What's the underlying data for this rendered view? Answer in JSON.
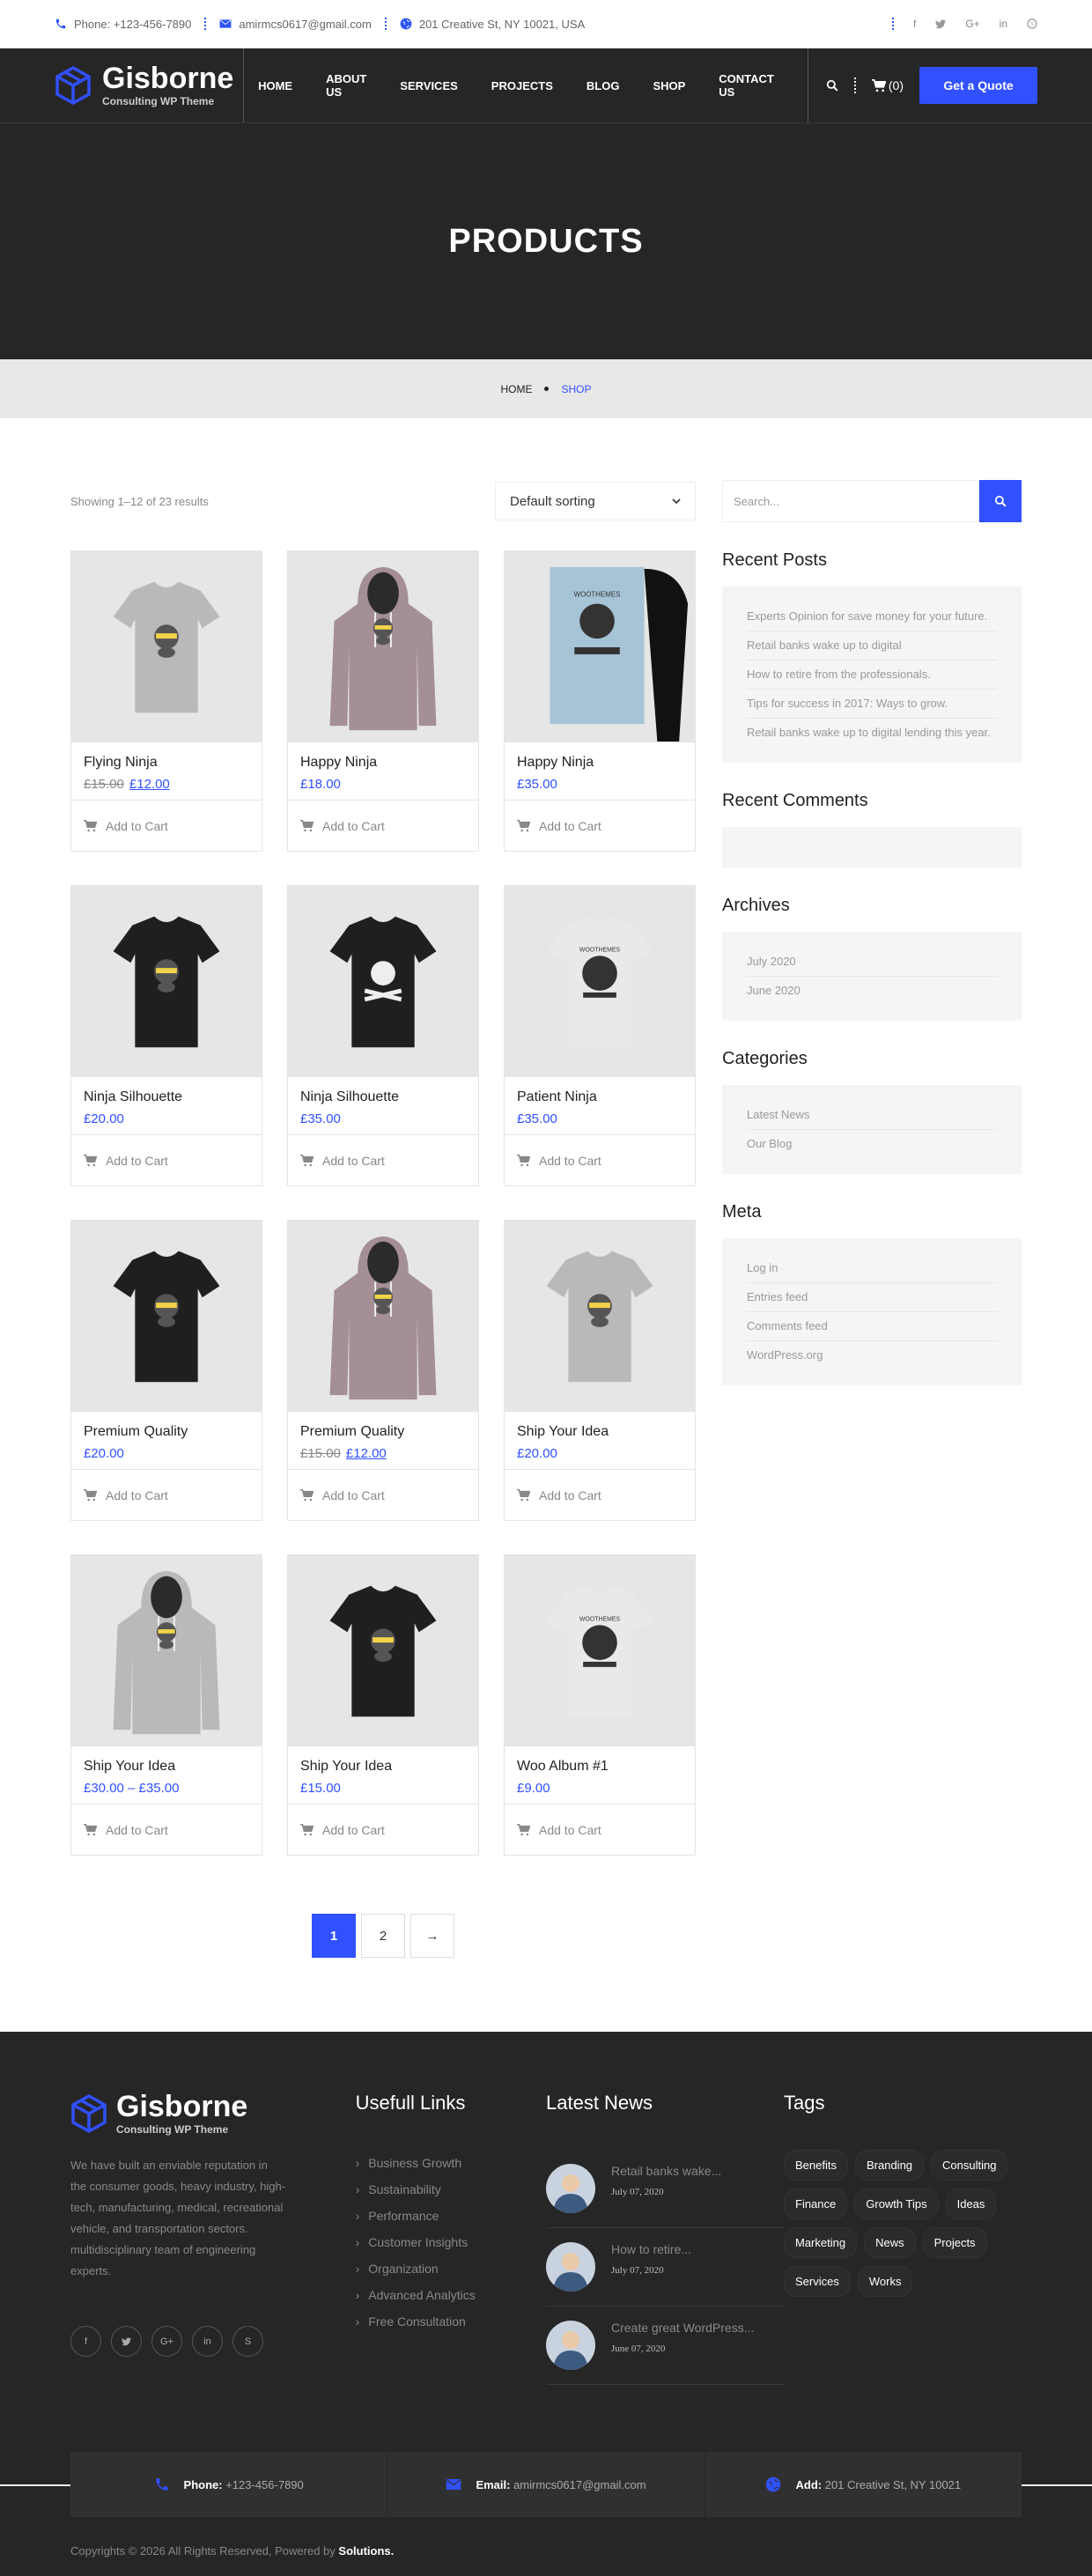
{
  "topbar": {
    "phone": "Phone: +123-456-7890",
    "email": "amirmcs0617@gmail.com",
    "address": "201 Creative St, NY 10021, USA"
  },
  "brand": {
    "name": "Gisborne",
    "tagline": "Consulting WP Theme"
  },
  "nav": [
    "HOME",
    "ABOUT US",
    "SERVICES",
    "PROJECTS",
    "BLOG",
    "SHOP",
    "CONTACT US"
  ],
  "header": {
    "cart": "(0)",
    "quote": "Get a Quote"
  },
  "hero": {
    "title": "PRODUCTS"
  },
  "breadcrumb": {
    "home": "HOME",
    "current": "SHOP"
  },
  "shop": {
    "result_count": "Showing 1–12 of 23 results",
    "sorting": "Default sorting",
    "add_to_cart": "Add to Cart"
  },
  "products": [
    {
      "name": "Flying Ninja",
      "old": "£15.00",
      "price": "£12.00",
      "kind": "tshirt-grey"
    },
    {
      "name": "Happy Ninja",
      "old": "",
      "price": "£18.00",
      "kind": "hoodie-pink"
    },
    {
      "name": "Happy Ninja",
      "old": "",
      "price": "£35.00",
      "kind": "poster"
    },
    {
      "name": "Ninja Silhouette",
      "old": "",
      "price": "£20.00",
      "kind": "tshirt-black"
    },
    {
      "name": "Ninja Silhouette",
      "old": "",
      "price": "£35.00",
      "kind": "tshirt-black-skull"
    },
    {
      "name": "Patient Ninja",
      "old": "",
      "price": "£35.00",
      "kind": "tshirt-white"
    },
    {
      "name": "Premium Quality",
      "old": "",
      "price": "£20.00",
      "kind": "tshirt-black"
    },
    {
      "name": "Premium Quality",
      "old": "£15.00",
      "price": "£12.00",
      "kind": "hoodie-pink"
    },
    {
      "name": "Ship Your Idea",
      "old": "",
      "price": "£20.00",
      "kind": "tshirt-grey"
    },
    {
      "name": "Ship Your Idea",
      "old": "",
      "price": "£30.00 – £35.00",
      "kind": "hoodie-grey"
    },
    {
      "name": "Ship Your Idea",
      "old": "",
      "price": "£15.00",
      "kind": "tshirt-black"
    },
    {
      "name": "Woo Album #1",
      "old": "",
      "price": "£9.00",
      "kind": "tshirt-white"
    }
  ],
  "pagination": [
    "1",
    "2",
    "→"
  ],
  "sidebar": {
    "search_placeholder": "Search...",
    "recent_posts_title": "Recent Posts",
    "recent_posts": [
      "Experts Opinion for save money for your future.",
      "Retail banks wake up to digital",
      "How to retire from the professionals.",
      "Tips for success in 2017: Ways to grow.",
      "Retail banks wake up to digital lending this year."
    ],
    "recent_comments_title": "Recent Comments",
    "archives_title": "Archives",
    "archives": [
      "July 2020",
      "June 2020"
    ],
    "categories_title": "Categories",
    "categories": [
      "Latest News",
      "Our Blog"
    ],
    "meta_title": "Meta",
    "meta": [
      "Log in",
      "Entries feed",
      "Comments feed",
      "WordPress.org"
    ]
  },
  "footer": {
    "about": "We have built an enviable reputation in the consumer goods, heavy industry, high-tech, manufacturing, medical, recreational vehicle, and transportation sectors. multidisciplinary team of engineering experts.",
    "links_title": "Usefull Links",
    "links": [
      "Business Growth",
      "Sustainability",
      "Performance",
      "Customer Insights",
      "Organization",
      "Advanced Analytics",
      "Free Consultation"
    ],
    "news_title": "Latest News",
    "news": [
      {
        "title": "Retail banks wake...",
        "date": "July 07, 2020"
      },
      {
        "title": "How to retire...",
        "date": "July 07, 2020"
      },
      {
        "title": "Create great WordPress...",
        "date": "June 07, 2020"
      }
    ],
    "tags_title": "Tags",
    "tags": [
      "Benefits",
      "Branding",
      "Consulting",
      "Finance",
      "Growth Tips",
      "Ideas",
      "Marketing",
      "News",
      "Projects",
      "Services",
      "Works"
    ],
    "phone_label": "Phone:",
    "phone": "+123-456-7890",
    "email_label": "Email:",
    "email": "amirmcs0617@gmail.com",
    "add_label": "Add:",
    "address": "201 Creative St, NY 10021",
    "copyright": "Copyrights © 2026 All Rights Reserved, Powered by ",
    "copyright_brand": "Solutions."
  }
}
